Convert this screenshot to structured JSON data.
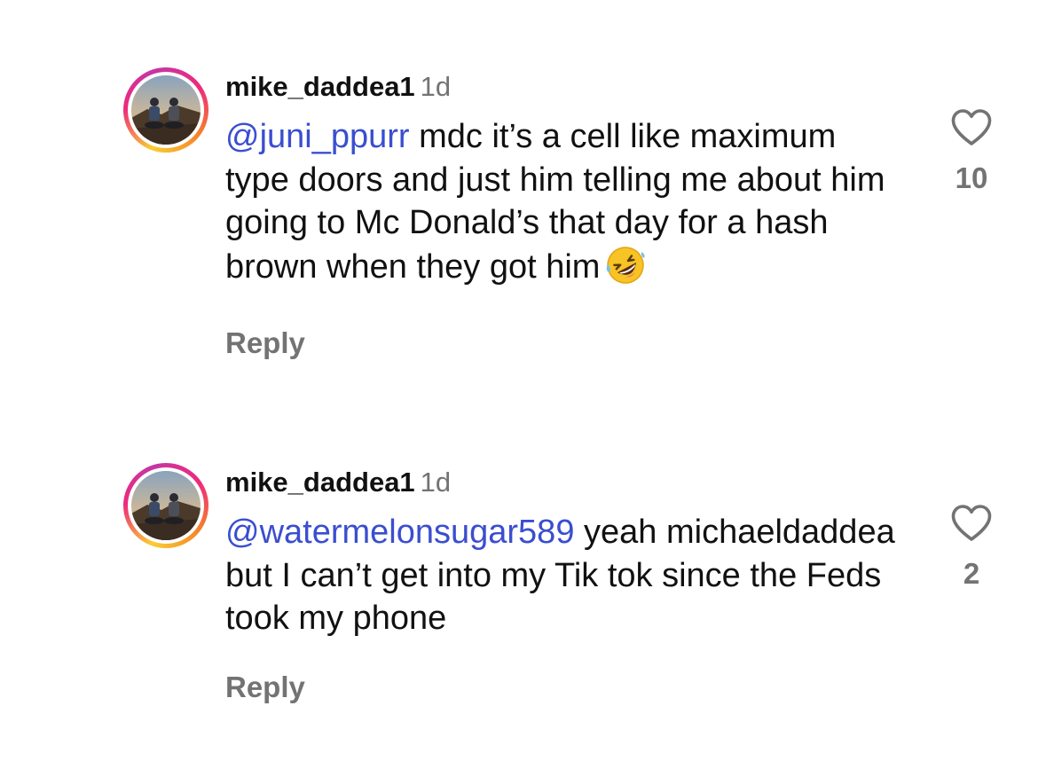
{
  "colors": {
    "mention": "#3a4ed0",
    "secondary_text": "#737373",
    "primary_text": "#111111",
    "story_ring": [
      "#f9ce34",
      "#ee2a7b",
      "#c536a4",
      "#f58529"
    ]
  },
  "comments": [
    {
      "avatar_icon": "user-avatar-photo",
      "username": "mike_daddea1",
      "timestamp": "1d",
      "mention": "@juni_ppurr",
      "text": " mdc it’s a cell like maximum type doors and just him telling me about him going to Mc Donald’s that day for a hash brown when they got him",
      "emoji": "rolling-on-the-floor-laughing-emoji",
      "reply_label": "Reply",
      "like_icon": "heart-icon",
      "like_count": "10"
    },
    {
      "avatar_icon": "user-avatar-photo",
      "username": "mike_daddea1",
      "timestamp": "1d",
      "mention": "@watermelonsugar589",
      "text": " yeah michaeldaddea but I can’t get into my Tik tok since the Feds took my phone",
      "reply_label": "Reply",
      "like_icon": "heart-icon",
      "like_count": "2"
    }
  ]
}
